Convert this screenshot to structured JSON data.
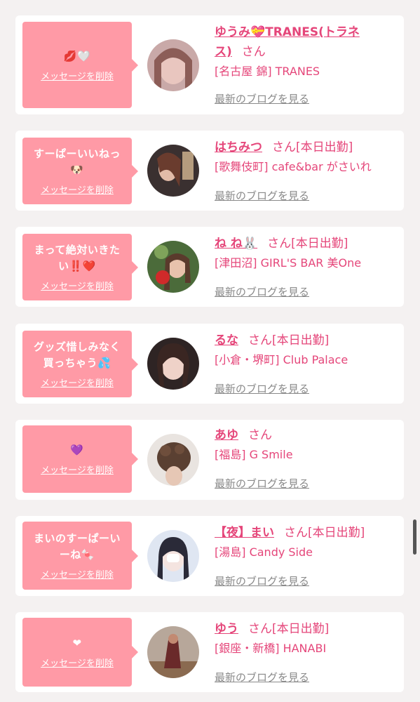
{
  "common": {
    "delete_label": "メッセージを削除",
    "blog_label": "最新のブログを見る",
    "san": "さん"
  },
  "cards": [
    {
      "message": "💋🤍",
      "name_line1": "ゆうみ💝TRANES(トラネ",
      "name_line2": "ス)",
      "status": "",
      "shop": "[名古屋 錦] TRANES"
    },
    {
      "message": "すーぱーいいねっ\n🐶",
      "name": "はちみつ",
      "status": "[本日出勤]",
      "shop": "[歌舞伎町] cafe&bar がさいれ"
    },
    {
      "message": "まって絶対いきた\nい‼️❤️",
      "name": "ね ね🐰",
      "status": "[本日出勤]",
      "shop": "[津田沼] GIRL'S BAR 美One"
    },
    {
      "message": "グッズ惜しみなく\n買っちゃう💦",
      "name": "るな",
      "status": "[本日出勤]",
      "shop": "[小倉・堺町] Club Palace"
    },
    {
      "message": "💜",
      "name": "あゆ",
      "status": "",
      "shop": "[福島] G Smile"
    },
    {
      "message": "まいのすーぱーい\nーね🍬",
      "name": "【夜】まい",
      "status": "[本日出勤]",
      "shop": "[湯島] Candy Side"
    },
    {
      "message": "❤",
      "name": "ゆう",
      "status": "[本日出勤]",
      "shop": "[銀座・新橋] HANABI"
    }
  ]
}
